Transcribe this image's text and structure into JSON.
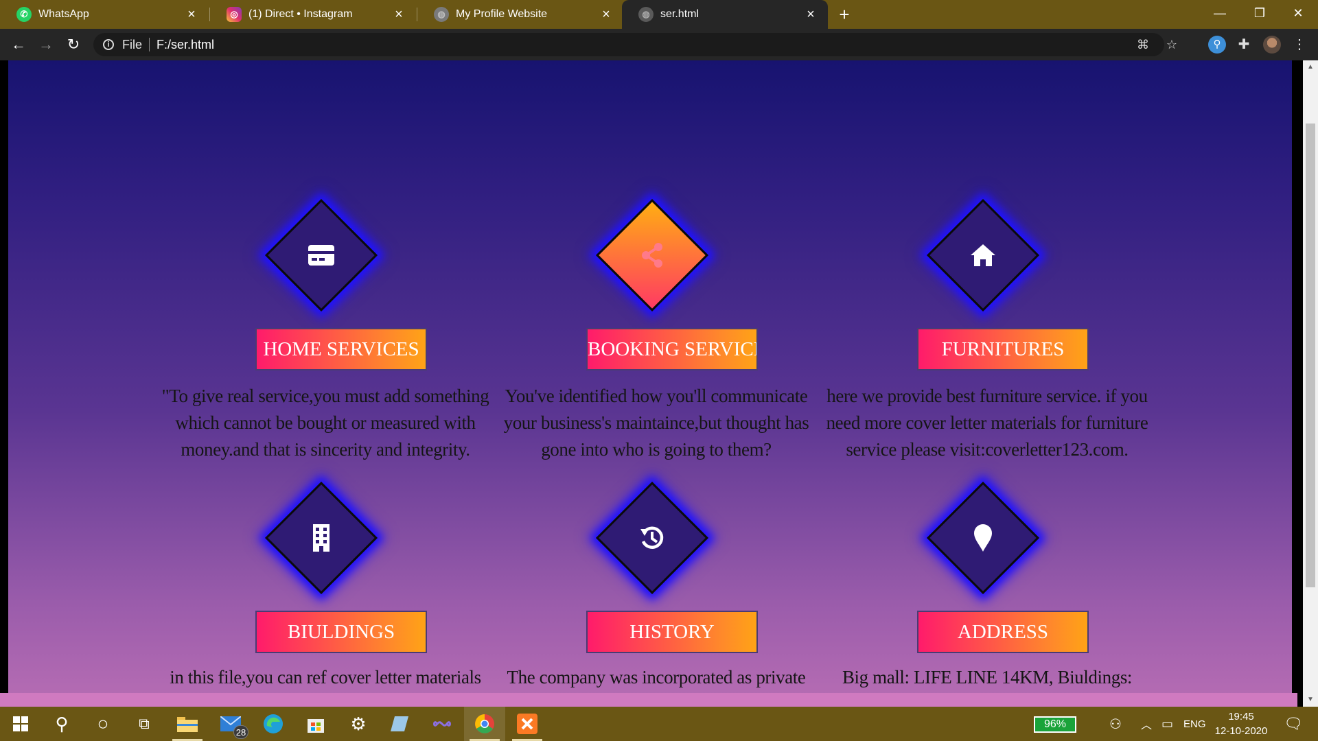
{
  "browser": {
    "tabs": [
      {
        "title": "WhatsApp",
        "icon": "whatsapp-icon",
        "icon_color": "#25d366"
      },
      {
        "title": "(1) Direct • Instagram",
        "icon": "instagram-icon",
        "icon_color": "#e1306c"
      },
      {
        "title": "My Profile Website",
        "icon": "globe-icon",
        "icon_color": "#8a8a8a"
      },
      {
        "title": "ser.html",
        "icon": "globe-icon",
        "icon_color": "#8a8a8a",
        "active": true
      }
    ],
    "address": {
      "scheme": "File",
      "url": "F:/ser.html"
    }
  },
  "page": {
    "services": [
      {
        "title": "HOME SERVICES",
        "icon": "credit-card-icon",
        "highlighted": false,
        "lines": [
          "\"To give real service,you must add something",
          "which cannot be bought or measured with",
          "money.and that is sincerity and integrity."
        ]
      },
      {
        "title": "BOOKING SERVICE",
        "icon": "share-icon",
        "highlighted": true,
        "lines": [
          "You've identified how you'll communicate",
          "your business's maintaince,but thought has",
          "gone into who is going to them?"
        ]
      },
      {
        "title": "FURNITURES",
        "icon": "home-icon",
        "highlighted": false,
        "lines": [
          "here we provide best furniture service. if you",
          "need more cover letter materials for furniture",
          "service please visit:coverletter123.com."
        ]
      },
      {
        "title": "BIULDINGS",
        "icon": "building-icon",
        "highlighted": false,
        "lines": [
          "in this file,you can ref cover letter materials"
        ]
      },
      {
        "title": "HISTORY",
        "icon": "history-icon",
        "highlighted": false,
        "lines": [
          "The company was incorporated as private"
        ]
      },
      {
        "title": "ADDRESS",
        "icon": "map-pin-icon",
        "highlighted": false,
        "lines": [
          "Big mall: LIFE LINE 14KM, Biuldings:"
        ]
      }
    ],
    "colors": {
      "bg_top": "#171370",
      "bg_bottom": "#b56cb3",
      "button_start": "#ff1b6b",
      "button_end": "#ffa316",
      "glow": "#1f12ff"
    }
  },
  "taskbar": {
    "mail_badge": "28",
    "battery": "96%",
    "language": "ENG",
    "time": "19:45",
    "date": "12-10-2020"
  }
}
